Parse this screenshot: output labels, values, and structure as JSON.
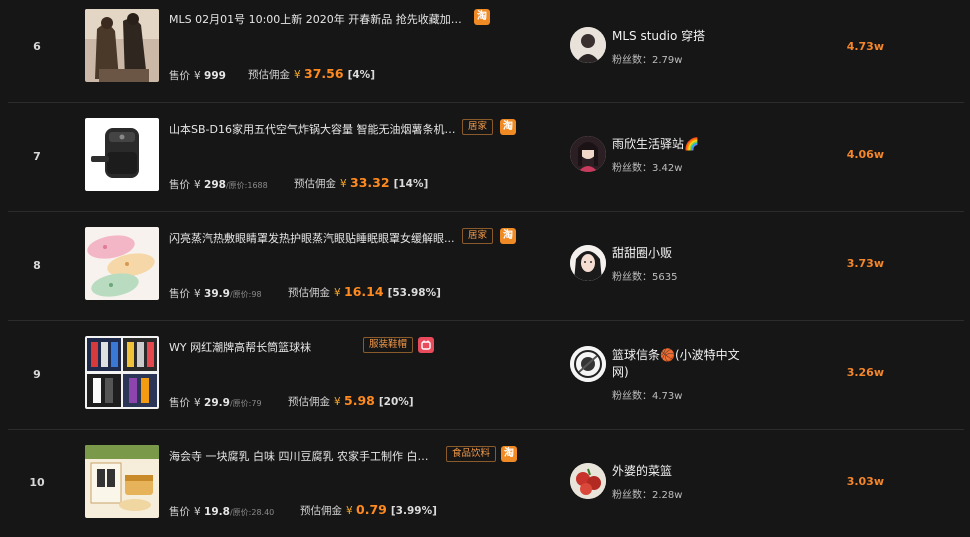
{
  "labels": {
    "price": "售价",
    "commission": "预估佣金",
    "fans": "粉丝数：",
    "currency": "¥",
    "original_price_prefix": "原价:"
  },
  "rows": [
    {
      "rank": "6",
      "title": "MLS 02月01号 10:00上新 2020年 开春新品 抢先收藏加购 更...",
      "category": "",
      "platform": "淘",
      "price": "999",
      "original_price": "",
      "commission": "37.56",
      "rate": "[4%]",
      "shop": "MLS studio 穿搭",
      "fans": "2.79w",
      "metric": "4.73w"
    },
    {
      "rank": "7",
      "title": "山本SB-D16家用五代空气炸锅大容量 智能无油烟薯条机电...",
      "category": "居家",
      "platform": "淘",
      "price": "298",
      "original_price": "1688",
      "commission": "33.32",
      "rate": "[14%]",
      "shop": "雨欣生活驿站🌈",
      "fans": "3.42w",
      "metric": "4.06w"
    },
    {
      "rank": "8",
      "title": "闪亮蒸汽热敷眼睛罩发热护眼蒸汽眼贴睡眠眼罩女缓解眼...",
      "category": "居家",
      "platform": "淘",
      "price": "39.9",
      "original_price": "98",
      "commission": "16.14",
      "rate": "[53.98%]",
      "shop": "甜甜圈小贩",
      "fans": "5635",
      "metric": "3.73w"
    },
    {
      "rank": "9",
      "title": "WY 网红潮牌高帮长筒篮球袜",
      "category": "服装鞋帽",
      "platform": "tmall",
      "price": "29.9",
      "original_price": "79",
      "commission": "5.98",
      "rate": "[20%]",
      "shop": "篮球信条🏀(小波特中文网)",
      "fans": "4.73w",
      "metric": "3.26w"
    },
    {
      "rank": "10",
      "title": "海会寺 一块腐乳 白味 四川豆腐乳 农家手工制作 白味 ...",
      "category": "食品饮料",
      "platform": "淘",
      "price": "19.8",
      "original_price": "28.40",
      "commission": "0.79",
      "rate": "[3.99%]",
      "shop": "外婆的菜篮",
      "fans": "2.28w",
      "metric": "3.03w"
    }
  ],
  "colors": {
    "background": "#161616",
    "accent": "#f5862a",
    "taobao": "#f08a24",
    "tmall": "#e94b5d"
  }
}
